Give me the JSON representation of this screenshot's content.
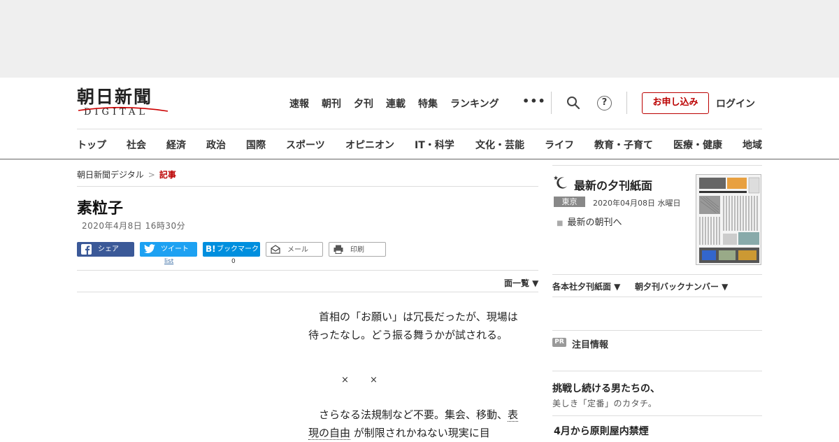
{
  "logo": {
    "main": "朝日新聞",
    "sub": "DIGITAL"
  },
  "top_nav": [
    "速報",
    "朝刊",
    "夕刊",
    "連載",
    "特集",
    "ランキング"
  ],
  "more_label": "•••",
  "help_label": "?",
  "apply_label": "お申し込み",
  "login_label": "ログイン",
  "categories": [
    "トップ",
    "社会",
    "経済",
    "政治",
    "国際",
    "スポーツ",
    "オピニオン",
    "IT・科学",
    "文化・芸能",
    "ライフ",
    "教育・子育て",
    "医療・健康",
    "地域"
  ],
  "breadcrumb": {
    "home": "朝日新聞デジタル",
    "sep": ">",
    "current": "記事"
  },
  "article": {
    "title": "素粒子",
    "date": "2020年4月8日 16時30分",
    "para1": "首相の「お願い」は冗長だったが、現場は待ったなし。どう振る舞うかが試される。",
    "cross": "×",
    "para2_pre": "さらなる法規制など不要。集会、移動、",
    "para2_link": "表現の自由",
    "para2_post": "が制限されかねない現実に目"
  },
  "share": {
    "facebook": "シェア",
    "twitter": "ツイート",
    "twitter_count": "list",
    "hatena": "ブックマーク",
    "hatena_badge": "B!",
    "hatena_count": "0",
    "mail": "メール",
    "print": "印刷"
  },
  "page_menu": "面一覧 ▼",
  "sidebar": {
    "title": "最新の夕刊紙面",
    "location": "東京",
    "date": "2020年04月08日 水曜日",
    "morning_link": "最新の朝刊へ",
    "drop1": "各本社夕刊紙面 ▼",
    "drop2": "朝夕刊バックナンバー ▼",
    "pr_badge": "PR",
    "pr_heading": "注目情報",
    "pr1_title": "挑戦し続ける男たちの、",
    "pr1_sub": "美しき「定番」のカタチ。",
    "pr2_title": "4月から原則屋内禁煙"
  },
  "colors": {
    "accent": "#bb0000",
    "facebook": "#3b5998",
    "twitter": "#1da1f2",
    "hatena": "#008fde"
  }
}
